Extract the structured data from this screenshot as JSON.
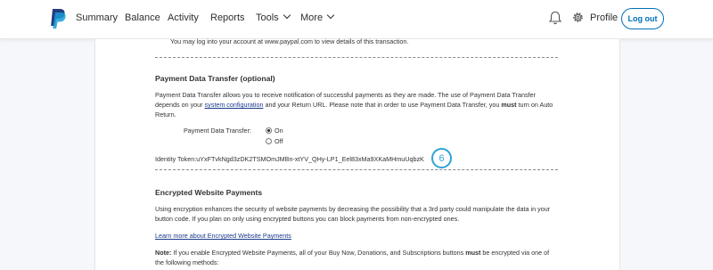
{
  "nav": {
    "items": [
      "Summary",
      "Balance",
      "Activity",
      "Reports",
      "Tools",
      "More"
    ],
    "profile_label": "Profile",
    "logout_label": "Log out"
  },
  "content": {
    "top_note": "You may log into your account at www.paypal.com to view details of this transaction.",
    "pdt": {
      "heading": "Payment Data Transfer (optional)",
      "para_line1": "Payment Data Transfer allows you to receive notification of successful payments as they are made. The use of Payment Data Transfer",
      "para_line2_pre": "depends on your ",
      "para_link": "system configuration",
      "para_line2_mid": " and your Return URL. Please note that in order to use Payment Data Transfer, you ",
      "para_bold": "must",
      "para_line2_post": " turn on Auto",
      "para_line3": "Return.",
      "setting_label": "Payment Data Transfer:",
      "option_on": "On",
      "option_off": "Off",
      "selected": "On",
      "identity_token": "Identity Token:uYxFTvkNgd3zDK2TSMOmJMBn-xtYV_QHy-LP1_Eel83xMa9XKaMHmuUqbzK",
      "step_badge": "6"
    },
    "ewp": {
      "heading": "Encrypted Website Payments",
      "para_line1": "Using encryption enhances the security of website payments by decreasing the possibility that a 3rd party could manipulate the data in your",
      "para_line2": "button code. If you plan on only using encrypted buttons you can block payments from non-encrypted ones.",
      "learn_more": "Learn more about Encrypted Website Payments",
      "note_label": "Note:",
      "note_line1_a": " If you enable Encrypted Website Payments, all of your Buy Now, Donations, and Subscriptions buttons ",
      "note_bold": "must",
      "note_line1_b": " be encrypted via one of",
      "note_line2": "the following methods:"
    }
  },
  "colors": {
    "accent": "#0070ba",
    "badge": "#2fa3d6",
    "logo_dark": "#253b80",
    "logo_light": "#179bd7"
  }
}
